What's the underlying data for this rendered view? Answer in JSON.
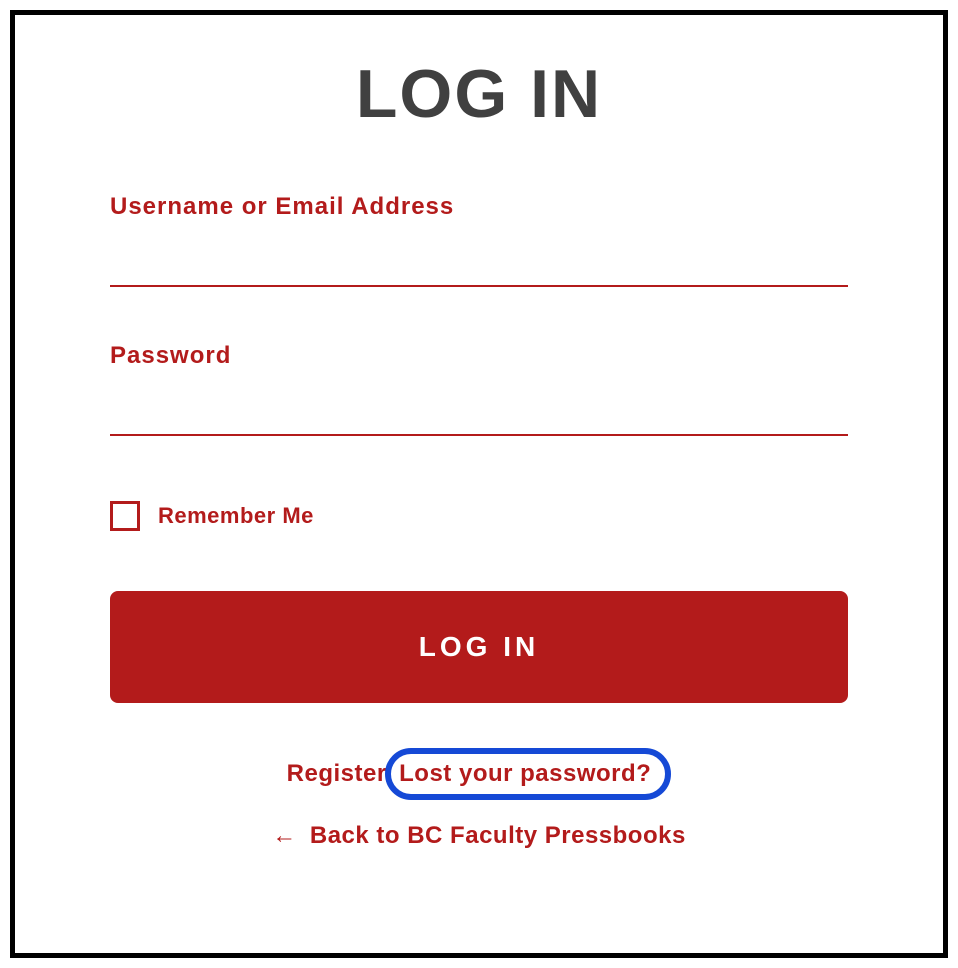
{
  "title": "LOG IN",
  "form": {
    "username_label": "Username or Email Address",
    "password_label": "Password",
    "remember_label": "Remember Me",
    "submit_label": "LOG IN"
  },
  "links": {
    "register": "Register",
    "lost_password": "Lost your password?",
    "back_arrow": "←",
    "back_text": "Back to BC Faculty Pressbooks"
  },
  "highlight": {
    "target": "lost-password-link",
    "color": "#1549d6"
  },
  "colors": {
    "primary": "#b31b1b",
    "title": "#404040"
  }
}
